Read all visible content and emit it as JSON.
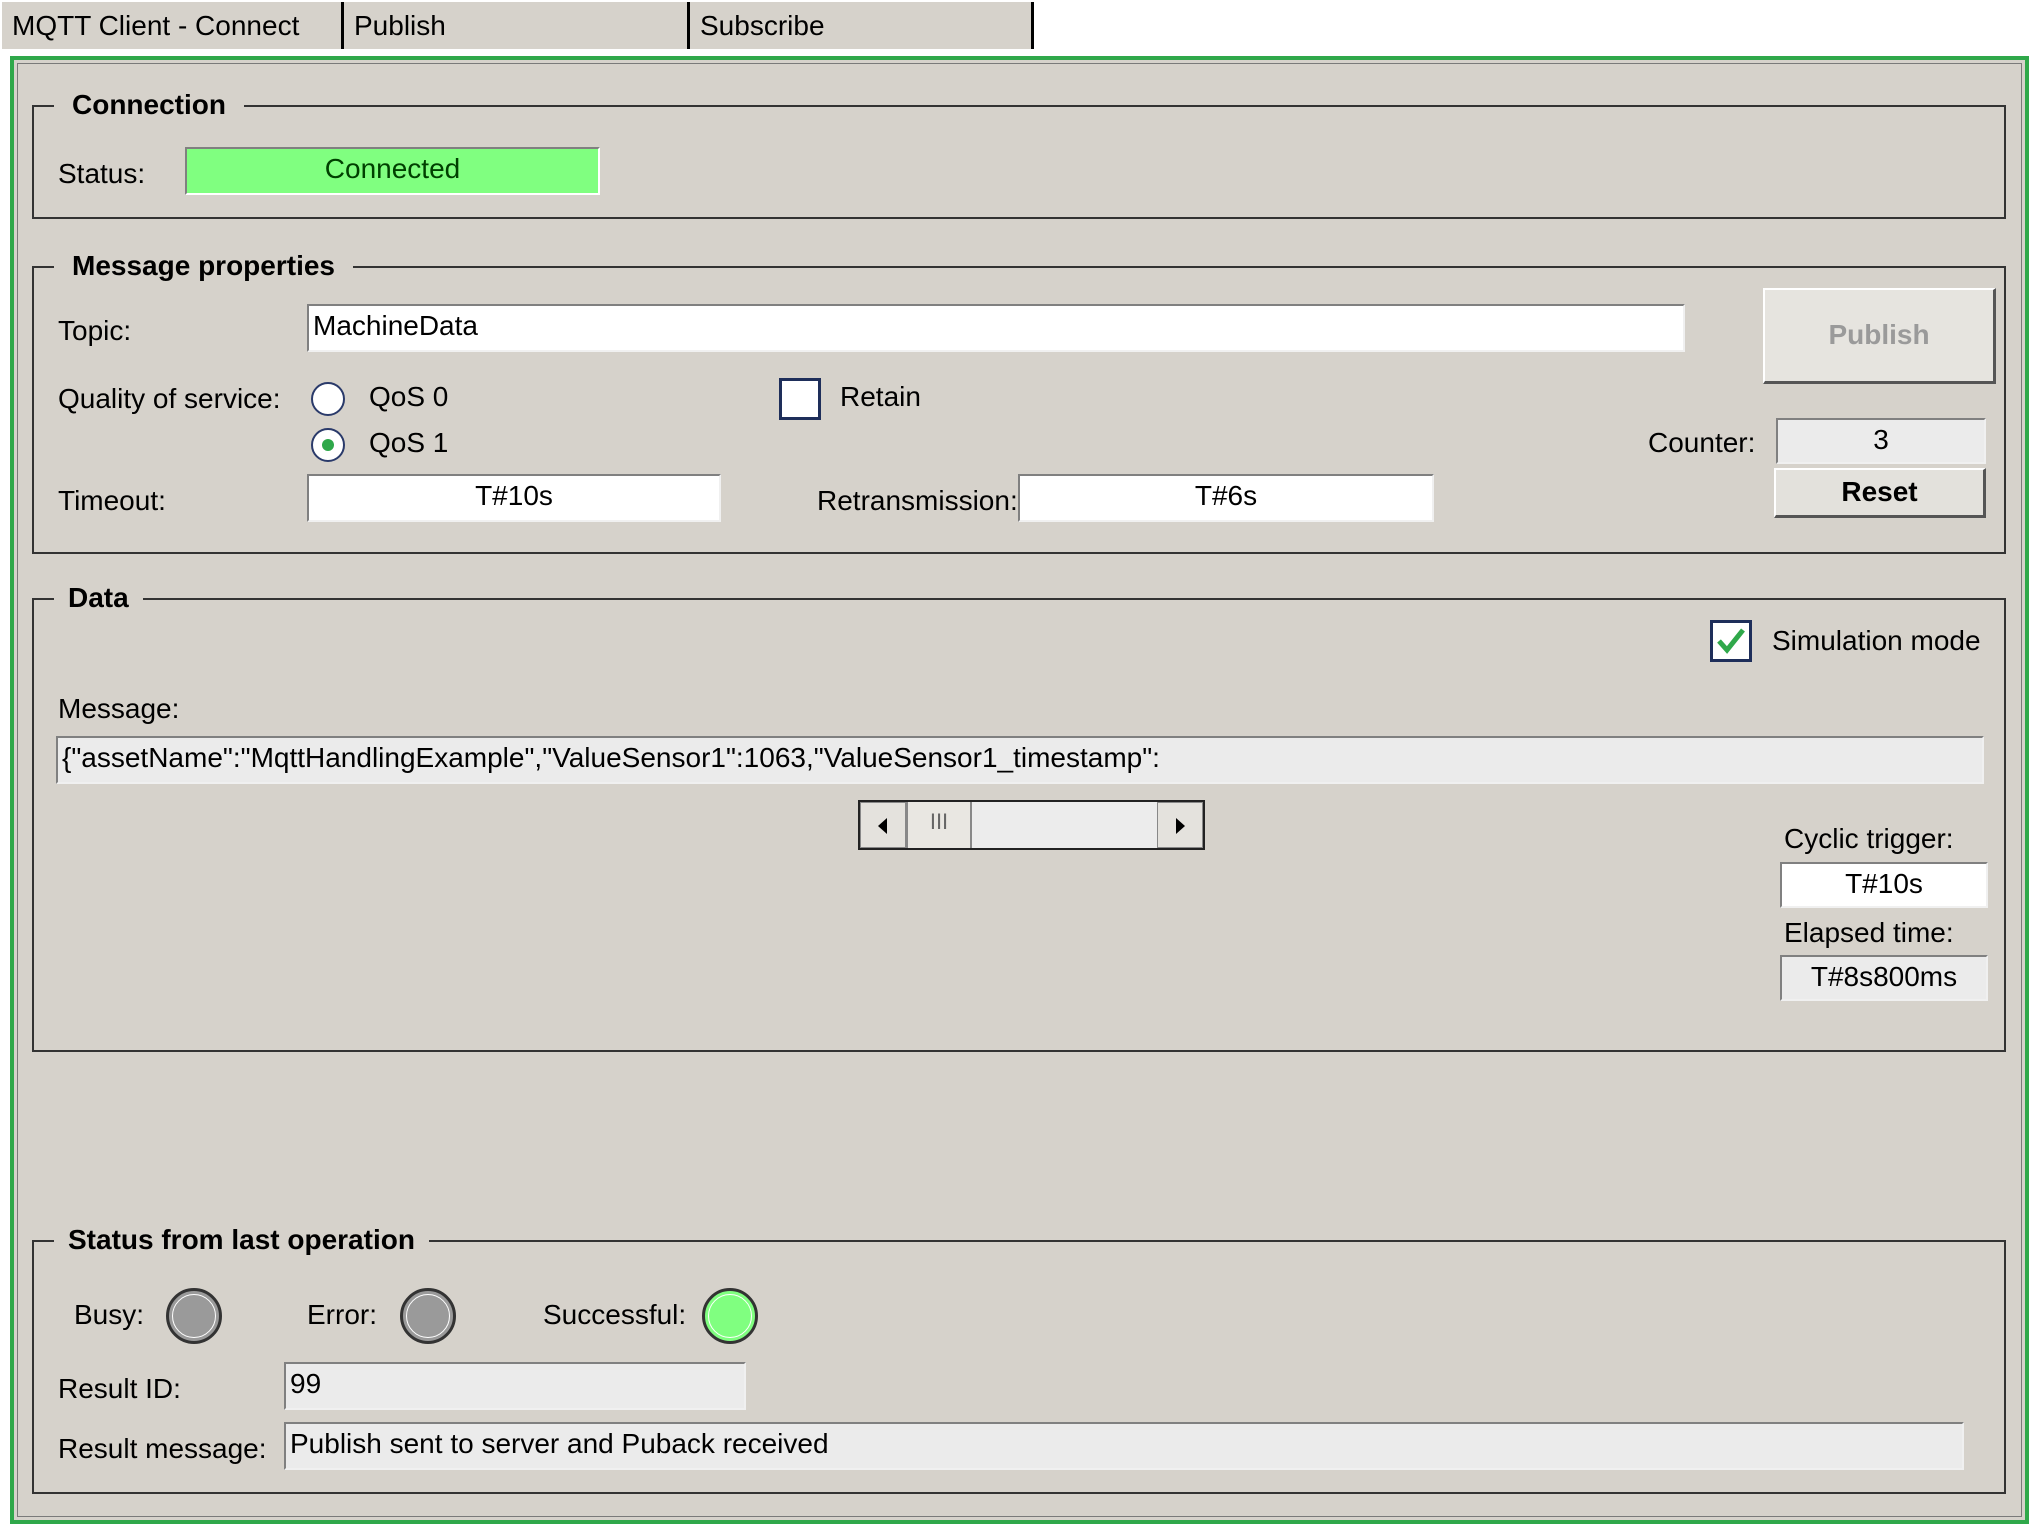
{
  "tabs": [
    {
      "label": "MQTT Client - Connect"
    },
    {
      "label": "Publish"
    },
    {
      "label": "Subscribe"
    }
  ],
  "connection": {
    "title": "Connection",
    "status_label": "Status:",
    "status_value": "Connected",
    "status_color": "#80ff80"
  },
  "message_properties": {
    "title": "Message properties",
    "topic_label": "Topic:",
    "topic_value": "MachineData",
    "qos_label": "Quality of service:",
    "qos_options": [
      {
        "label": "QoS 0",
        "checked": false
      },
      {
        "label": "QoS 1",
        "checked": true
      }
    ],
    "retain_label": "Retain",
    "retain_checked": false,
    "timeout_label": "Timeout:",
    "timeout_value": "T#10s",
    "retransmission_label": "Retransmission:",
    "retransmission_value": "T#6s",
    "publish_label": "Publish",
    "counter_label": "Counter:",
    "counter_value": "3",
    "reset_label": "Reset"
  },
  "data": {
    "title": "Data",
    "simulation_label": "Simulation mode",
    "simulation_checked": true,
    "message_label": "Message:",
    "message_value": "{\"assetName\":\"MqttHandlingExample\",\"ValueSensor1\":1063,\"ValueSensor1_timestamp\":",
    "scroll_grip": "III",
    "cyclic_label": "Cyclic trigger:",
    "cyclic_value": "T#10s",
    "elapsed_label": "Elapsed time:",
    "elapsed_value": "T#8s800ms"
  },
  "status": {
    "title": "Status from last operation",
    "busy_label": "Busy:",
    "error_label": "Error:",
    "successful_label": "Successful:",
    "busy_color": "#9a9a9a",
    "error_color": "#9a9a9a",
    "successful_color": "#80ff80",
    "result_id_label": "Result ID:",
    "result_id_value": "99",
    "result_message_label": "Result message:",
    "result_message_value": "Publish sent to server and Puback received"
  }
}
